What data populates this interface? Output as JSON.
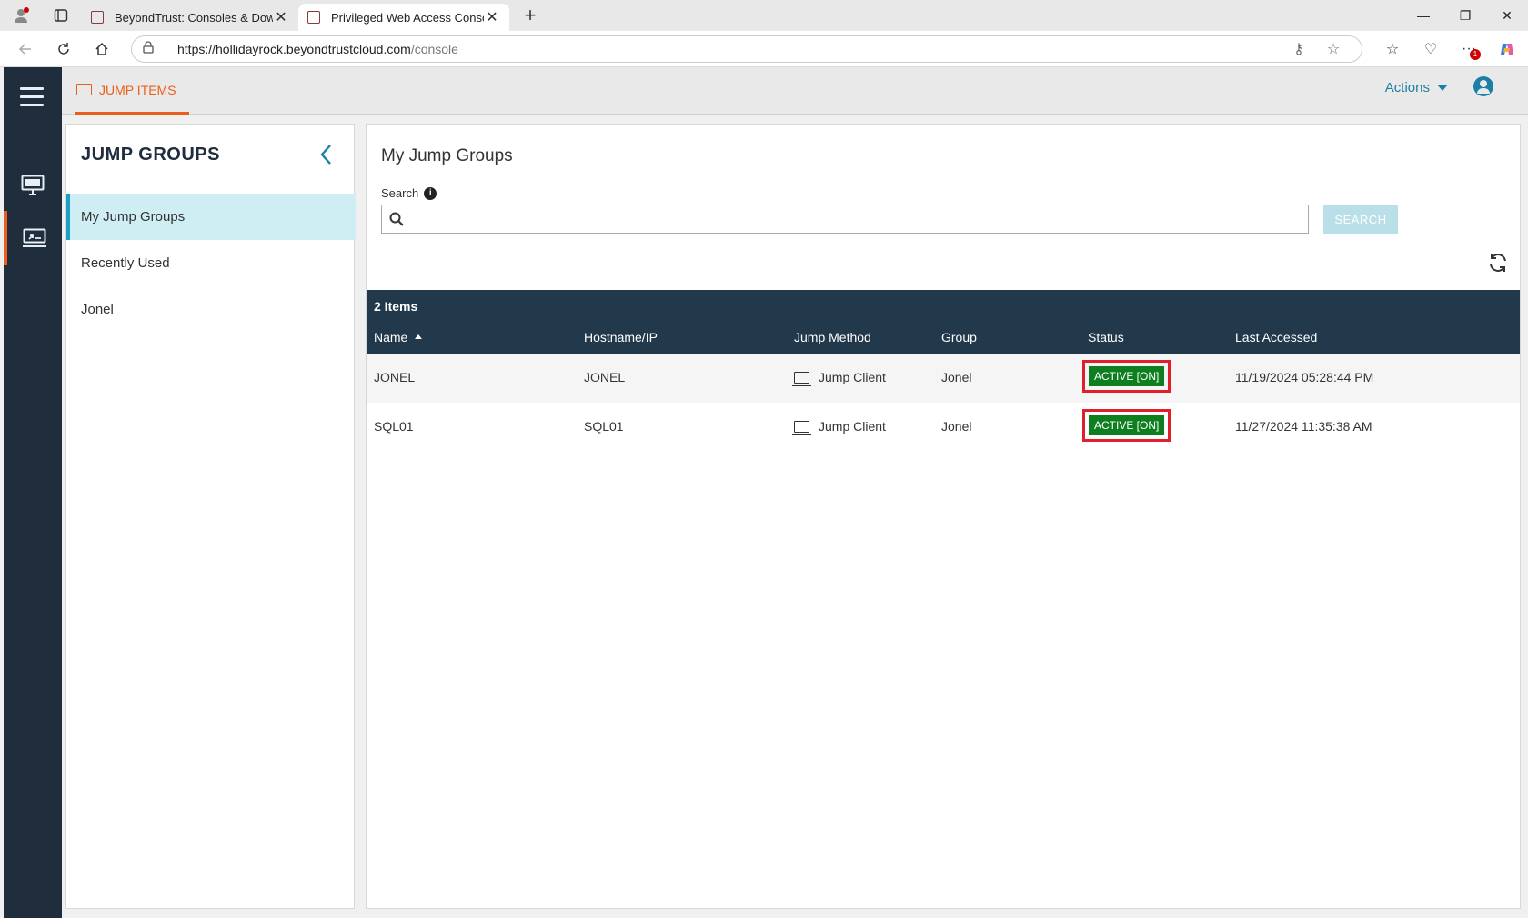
{
  "browser": {
    "tabs": [
      {
        "title": "BeyondTrust: Consoles & Downlo",
        "active": false
      },
      {
        "title": "Privileged Web Access Console - ",
        "active": true
      }
    ],
    "url_host": "https://hollidayrock.beyondtrustcloud.com",
    "url_path": "/console",
    "extension_badge": "1"
  },
  "topbar": {
    "tab_label": "JUMP ITEMS",
    "actions_label": "Actions"
  },
  "sidebar": {
    "title": "JUMP GROUPS",
    "items": [
      {
        "label": "My Jump Groups",
        "selected": true
      },
      {
        "label": "Recently Used",
        "selected": false
      },
      {
        "label": "Jonel",
        "selected": false
      }
    ]
  },
  "main": {
    "title": "My Jump Groups",
    "search_label": "Search",
    "search_value": "",
    "search_button": "SEARCH",
    "item_count": "2 Items",
    "columns": [
      "Name",
      "Hostname/IP",
      "Jump Method",
      "Group",
      "Status",
      "Last Accessed"
    ],
    "rows": [
      {
        "name": "JONEL",
        "hostname": "JONEL",
        "method": "Jump Client",
        "group": "Jonel",
        "status": "ACTIVE [ON]",
        "last_accessed": "11/19/2024 05:28:44 PM"
      },
      {
        "name": "SQL01",
        "hostname": "SQL01",
        "method": "Jump Client",
        "group": "Jonel",
        "status": "ACTIVE [ON]",
        "last_accessed": "11/27/2024 11:35:38 AM"
      }
    ]
  },
  "colors": {
    "accent_orange": "#e8601c",
    "nav_dark": "#1f2d3d",
    "table_header": "#22384b",
    "link_blue": "#1b7fa6",
    "status_green": "#0e7f1e",
    "highlight_red": "#e01f2a"
  }
}
